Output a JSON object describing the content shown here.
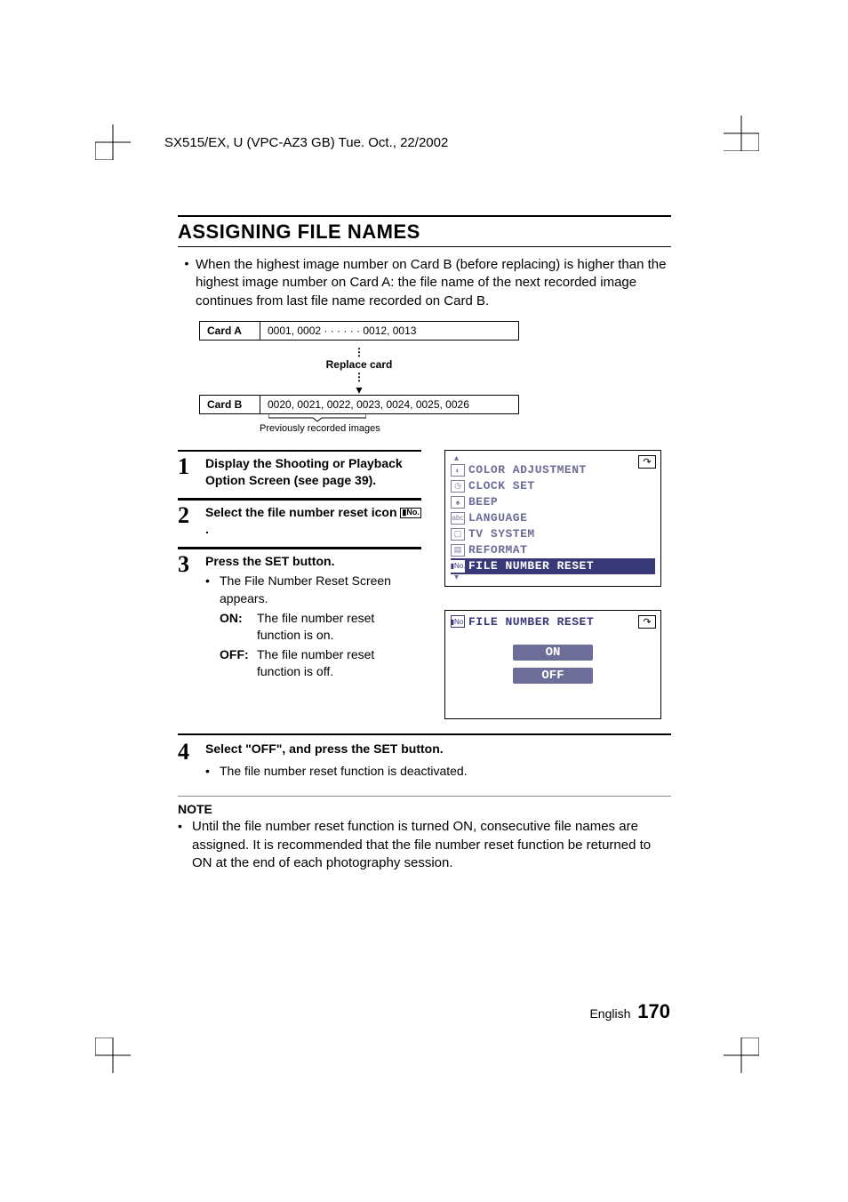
{
  "header": "SX515/EX, U (VPC-AZ3 GB)    Tue. Oct., 22/2002",
  "title": "ASSIGNING FILE NAMES",
  "intro": "When the highest image number on Card B (before replacing) is higher than the highest image number on Card A: the file name of the next recorded image continues from last file name recorded on Card B.",
  "diagram": {
    "rowA_label": "Card A",
    "rowA_vals": "0001, 0002 · · · · · · 0012, 0013",
    "replace": "Replace card",
    "rowB_label": "Card B",
    "rowB_vals": "0020, 0021, 0022, 0023, 0024, 0025, 0026",
    "note": "Previously recorded images"
  },
  "steps": {
    "s1_title": "Display the Shooting or Playback Option Screen (see page 39).",
    "s2_title": "Select the file number reset icon ",
    "s2_tail": ".",
    "s3_title": "Press the SET button.",
    "s3_sub1": "The File Number Reset Screen appears.",
    "s3_on_label": "ON:",
    "s3_on_text": "The file number reset function is on.",
    "s3_off_label": "OFF:",
    "s3_off_text": "The file number reset function is off.",
    "s4_title": "Select \"OFF\", and press the SET button.",
    "s4_sub1": "The file number reset function is deactivated."
  },
  "menu": {
    "items": [
      "COLOR ADJUSTMENT",
      "CLOCK SET",
      "BEEP",
      "LANGUAGE",
      "TV SYSTEM",
      "REFORMAT",
      "FILE NUMBER RESET"
    ]
  },
  "screen2": {
    "title": "FILE NUMBER RESET",
    "on": "ON",
    "off": "OFF"
  },
  "note": {
    "title": "NOTE",
    "text": "Until the file number reset function is turned ON, consecutive file names are assigned. It is recommended that the file number reset function be returned to ON at the end of each photography session."
  },
  "footer": {
    "lang": "English",
    "page": "170"
  }
}
